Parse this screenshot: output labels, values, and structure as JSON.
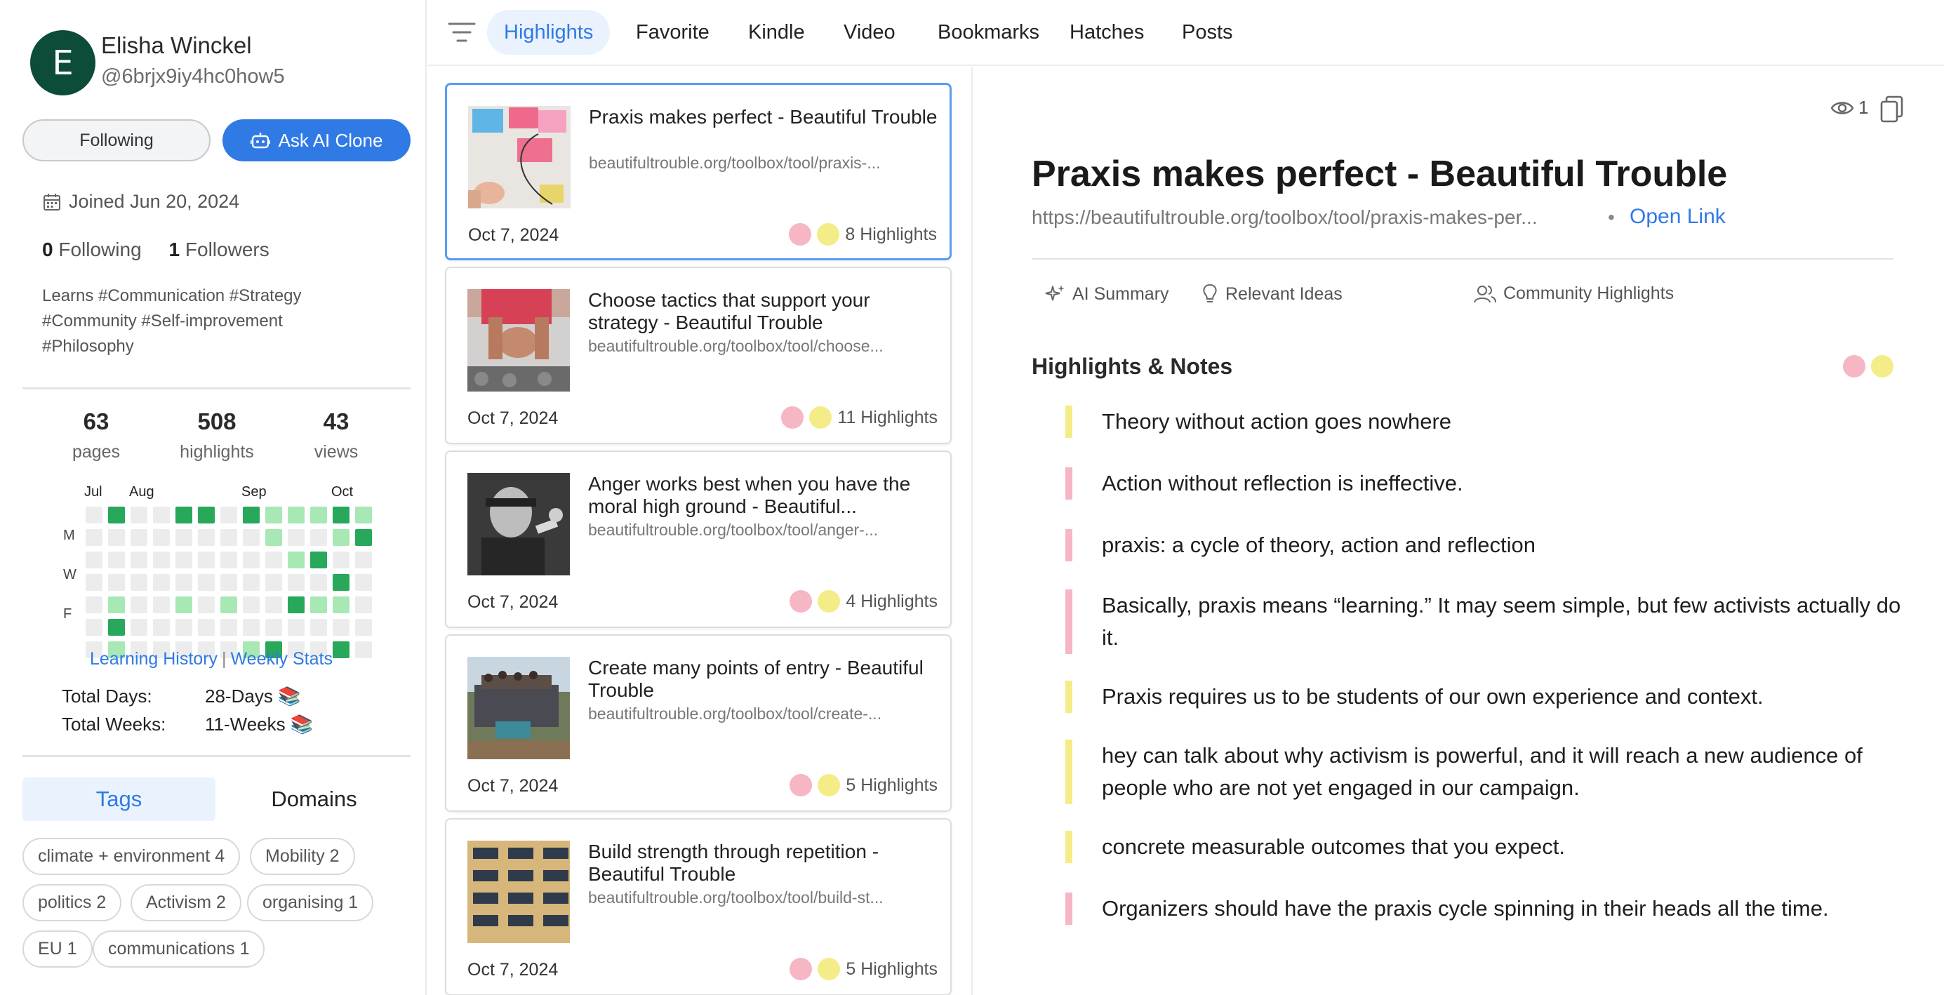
{
  "colors": {
    "accent": "#2f7ae5",
    "avatar_bg": "#0d4b3a",
    "pink": "#f6b6c4",
    "yellow": "#f4ec86"
  },
  "profile": {
    "avatar_letter": "E",
    "name": "Elisha Winckel",
    "handle": "@6brjx9iy4hc0how5",
    "following_btn": "Following",
    "ai_clone_btn": "Ask AI Clone",
    "joined": "Joined Jun 20, 2024",
    "following_count": "0",
    "following_label": "Following",
    "followers_count": "1",
    "followers_label": "Followers",
    "interests": "Learns #Communication #Strategy #Community #Self-improvement #Philosophy"
  },
  "stats": [
    {
      "num": "63",
      "label": "pages"
    },
    {
      "num": "508",
      "label": "highlights"
    },
    {
      "num": "43",
      "label": "views"
    }
  ],
  "heatmap": {
    "months": [
      "Jul",
      "Aug",
      "Sep",
      "Oct"
    ],
    "days": [
      "M",
      "W",
      "F"
    ],
    "levels": [
      [
        0,
        0,
        0,
        0,
        0,
        0,
        0
      ],
      [
        3,
        0,
        0,
        0,
        1,
        3,
        1
      ],
      [
        0,
        0,
        0,
        0,
        0,
        0,
        0
      ],
      [
        0,
        0,
        0,
        0,
        0,
        0,
        0
      ],
      [
        3,
        0,
        0,
        0,
        1,
        0,
        0
      ],
      [
        3,
        0,
        0,
        0,
        0,
        0,
        0
      ],
      [
        0,
        0,
        0,
        0,
        1,
        0,
        0
      ],
      [
        3,
        0,
        0,
        0,
        0,
        0,
        1
      ],
      [
        1,
        1,
        0,
        0,
        0,
        0,
        3
      ],
      [
        1,
        0,
        1,
        0,
        3,
        0,
        0
      ],
      [
        1,
        0,
        3,
        0,
        1,
        0,
        0
      ],
      [
        3,
        1,
        0,
        3,
        1,
        0,
        3
      ],
      [
        1,
        3,
        0,
        0,
        0,
        0,
        0
      ]
    ],
    "link_history": "Learning History",
    "link_weekly": "Weekly Stats",
    "total_days_label": "Total Days:",
    "total_days_value": "28-Days 📚",
    "total_weeks_label": "Total Weeks:",
    "total_weeks_value": "11-Weeks 📚"
  },
  "bottom_tabs": {
    "tags": "Tags",
    "domains": "Domains"
  },
  "tags": [
    "climate + environment 4",
    "Mobility 2",
    "politics 2",
    "Activism 2",
    "organising 1",
    "EU 1",
    "communications 1"
  ],
  "nav": {
    "items": [
      "Highlights",
      "Favorite",
      "Kindle",
      "Video",
      "Bookmarks",
      "Hatches",
      "Posts"
    ],
    "active": "Highlights"
  },
  "articles": [
    {
      "title": "Praxis makes perfect - Beautiful Trouble",
      "url": "beautifultrouble.org/toolbox/tool/praxis-...",
      "date": "Oct 7, 2024",
      "highlights": "8 Highlights"
    },
    {
      "title": "Choose tactics that support your strategy - Beautiful Trouble",
      "url": "beautifultrouble.org/toolbox/tool/choose...",
      "date": "Oct 7, 2024",
      "highlights": "11 Highlights"
    },
    {
      "title": "Anger works best when you have the moral high ground - Beautiful...",
      "url": "beautifultrouble.org/toolbox/tool/anger-...",
      "date": "Oct 7, 2024",
      "highlights": "4 Highlights"
    },
    {
      "title": "Create many points of entry - Beautiful Trouble",
      "url": "beautifultrouble.org/toolbox/tool/create-...",
      "date": "Oct 7, 2024",
      "highlights": "5 Highlights"
    },
    {
      "title": "Build strength through repetition - Beautiful Trouble",
      "url": "beautifultrouble.org/toolbox/tool/build-st...",
      "date": "Oct 7, 2024",
      "highlights": "5 Highlights"
    }
  ],
  "detail": {
    "views": "1",
    "title": "Praxis makes perfect - Beautiful Trouble",
    "url": "https://beautifultrouble.org/toolbox/tool/praxis-makes-per...",
    "bullet": "•",
    "open_link": "Open Link",
    "tab_summary": "AI Summary",
    "tab_ideas": "Relevant Ideas",
    "tab_community": "Community Highlights",
    "section_title": "Highlights & Notes",
    "highlights": [
      {
        "text": "Theory without action goes nowhere",
        "color": "yellow"
      },
      {
        "text": "Action without reflection is ineffective.",
        "color": "pink"
      },
      {
        "text": "praxis: a cycle of theory, action and reflection",
        "color": "pink"
      },
      {
        "text": "Basically, praxis means “learning.” It may seem simple, but few activists actually do it.",
        "color": "pink"
      },
      {
        "text": "Praxis requires us to be students of our own experience and context.",
        "color": "yellow"
      },
      {
        "text": "hey can talk about why activism is powerful, and it will reach a new audience of people who are not yet engaged in our campaign.",
        "color": "yellow"
      },
      {
        "text": "concrete measurable outcomes that you expect.",
        "color": "yellow"
      },
      {
        "text": "Organizers should have the praxis cycle spinning in their heads all the time.",
        "color": "pink"
      }
    ]
  }
}
